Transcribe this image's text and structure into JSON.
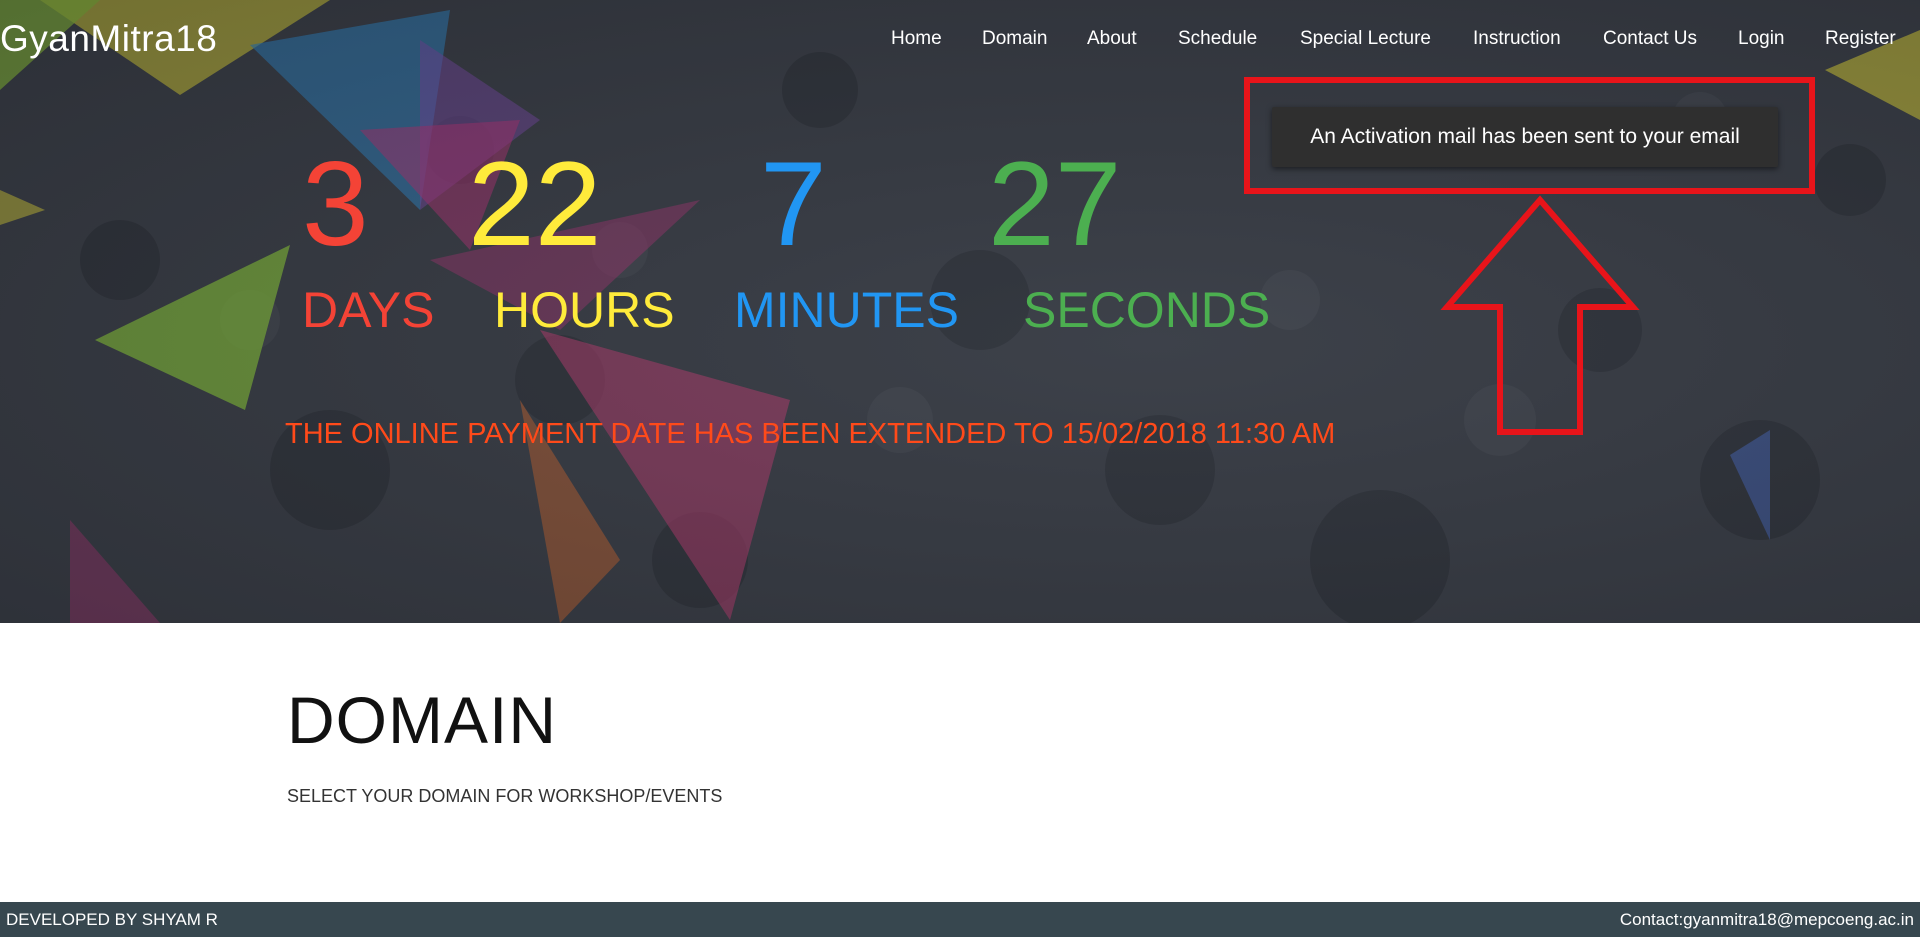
{
  "brand": "GyanMitra18",
  "nav": {
    "items": [
      "Home",
      "Domain",
      "About",
      "Schedule",
      "Special Lecture",
      "Instruction",
      "Contact Us",
      "Login",
      "Register"
    ]
  },
  "countdown": {
    "days": {
      "value": "3",
      "label": "DAYS",
      "color": "#f44336"
    },
    "hours": {
      "value": "22",
      "label": "HOURS",
      "color": "#ffeb3b"
    },
    "minutes": {
      "value": "7",
      "label": "MINUTES",
      "color": "#2196f3"
    },
    "seconds": {
      "value": "27",
      "label": "SECONDS",
      "color": "#4caf50"
    }
  },
  "notice": "THE ONLINE PAYMENT DATE HAS BEEN EXTENDED TO 15/02/2018 11:30 AM",
  "toast": "An Activation mail has been sent to your email",
  "domain": {
    "title": "DOMAIN",
    "subtitle": "SELECT YOUR DOMAIN FOR WORKSHOP/EVENTS"
  },
  "footer": {
    "left": "DEVELOPED BY SHYAM R",
    "right": "Contact:gyanmitra18@mepcoeng.ac.in"
  },
  "colors": {
    "hero_bg": "#2f333b",
    "highlight": "#e8141a",
    "notice": "#ff4a1a",
    "footer_bg": "#37474f"
  }
}
